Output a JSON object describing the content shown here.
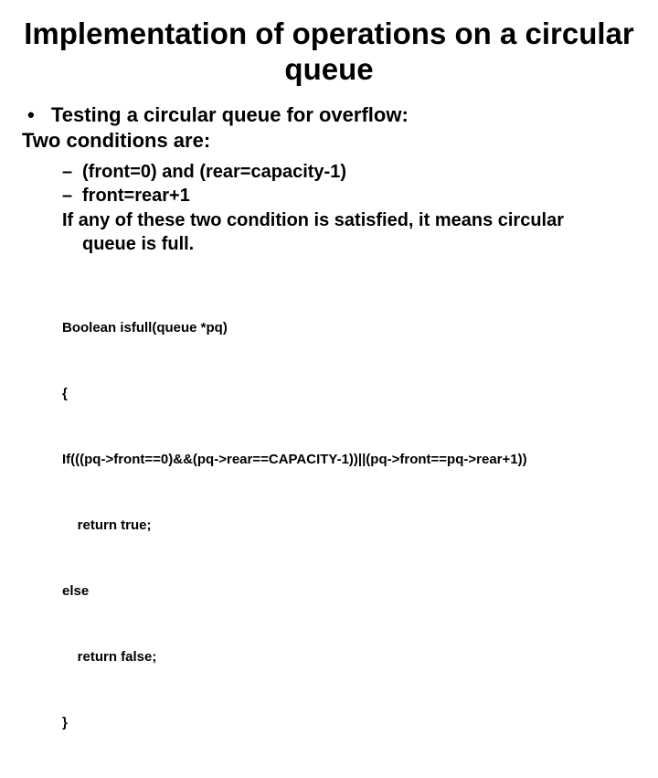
{
  "title": "Implementation of operations on a circular queue",
  "body": {
    "b1": "Testing a circular queue for overflow:",
    "b2": "Two conditions are:"
  },
  "sub": {
    "d1": "(front=0) and (rear=capacity-1)",
    "d2": "front=rear+1",
    "if_line": "If any of these two condition is satisfied, it means circular",
    "if_line2": "queue is full."
  },
  "code": {
    "l1": "Boolean isfull(queue *pq)",
    "l2": "{",
    "l3": "If(((pq->front==0)&&(pq->rear==CAPACITY-1))||(pq->front==pq->rear+1))",
    "l4": "    return true;",
    "l5": "else",
    "l6": "    return false;",
    "l7": "}"
  }
}
